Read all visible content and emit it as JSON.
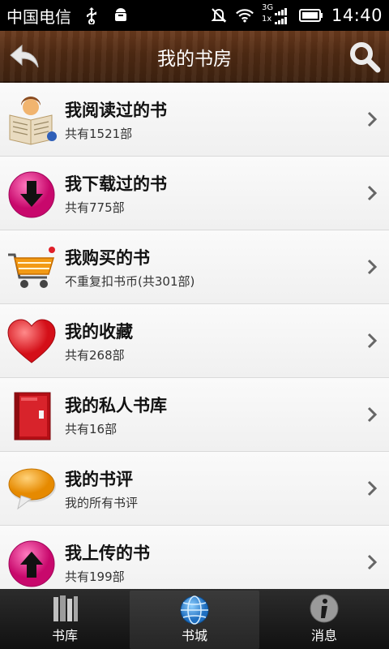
{
  "status_bar": {
    "carrier": "中国电信",
    "network": "3G",
    "network2": "1x",
    "time": "14:40"
  },
  "header": {
    "title": "我的书房"
  },
  "list": {
    "items": [
      {
        "title": "我阅读过的书",
        "subtitle": "共有1521部",
        "icon": "reader-icon"
      },
      {
        "title": "我下载过的书",
        "subtitle": "共有775部",
        "icon": "download-icon"
      },
      {
        "title": "我购买的书",
        "subtitle": "不重复扣书币(共301部)",
        "icon": "cart-icon"
      },
      {
        "title": "我的收藏",
        "subtitle": "共有268部",
        "icon": "heart-icon"
      },
      {
        "title": "我的私人书库",
        "subtitle": "共有16部",
        "icon": "cabinet-icon"
      },
      {
        "title": "我的书评",
        "subtitle": "我的所有书评",
        "icon": "comment-icon"
      },
      {
        "title": "我上传的书",
        "subtitle": "共有199部",
        "icon": "upload-icon"
      }
    ]
  },
  "tabs": [
    {
      "label": "书库",
      "icon": "books-icon",
      "active": false
    },
    {
      "label": "书城",
      "icon": "globe-icon",
      "active": true
    },
    {
      "label": "消息",
      "icon": "info-icon",
      "active": false
    }
  ],
  "colors": {
    "header_wood": "#4f2a13",
    "download_pink": "#e0157f",
    "heart_red": "#e8202a",
    "cabinet_red": "#c8121c",
    "comment_orange": "#f4a014"
  }
}
